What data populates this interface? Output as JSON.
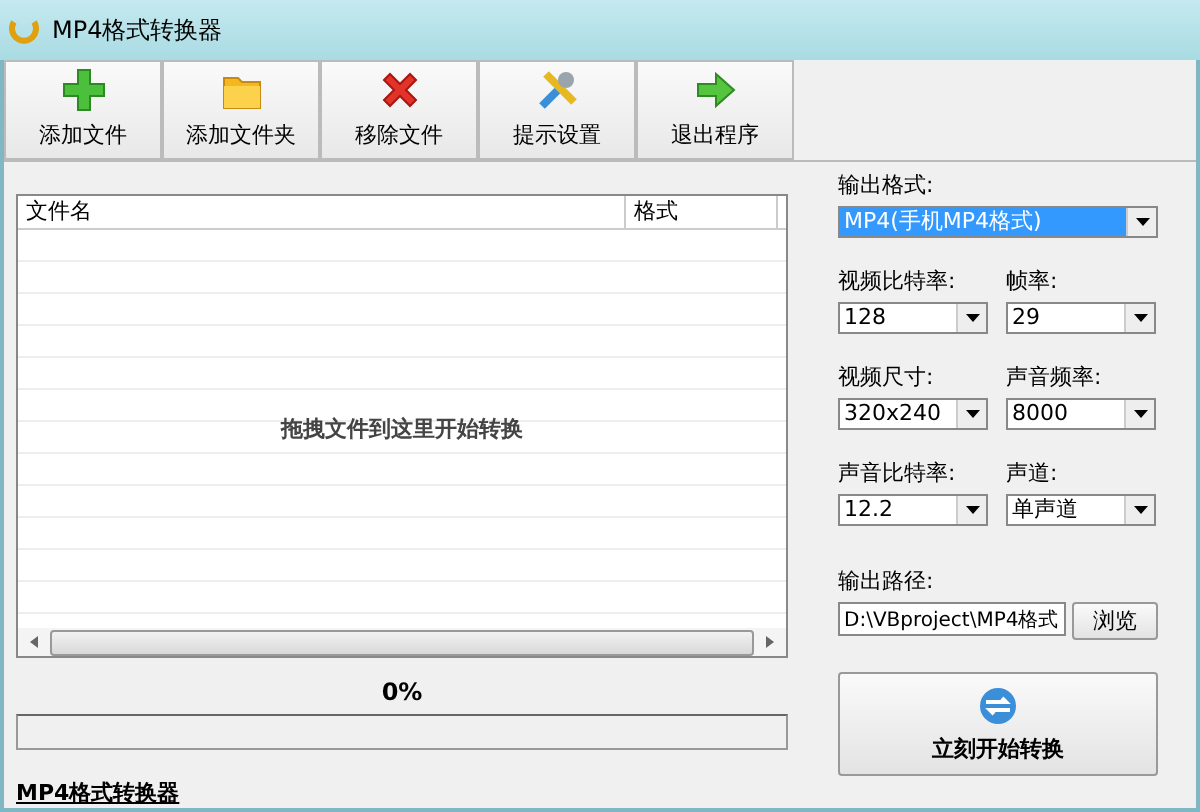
{
  "window": {
    "title": "MP4格式转换器"
  },
  "toolbar": [
    {
      "label": "添加文件",
      "kind": "add"
    },
    {
      "label": "添加文件夹",
      "kind": "folder"
    },
    {
      "label": "移除文件",
      "kind": "remove"
    },
    {
      "label": "提示设置",
      "kind": "tools"
    },
    {
      "label": "退出程序",
      "kind": "exit"
    }
  ],
  "file_list": {
    "columns": [
      "文件名",
      "格式"
    ],
    "empty_hint": "拖拽文件到这里开始转换"
  },
  "progress": {
    "reading": "0%",
    "level": 0
  },
  "footer_link": "MP4格式转换器",
  "output_format": {
    "label": "输出格式:",
    "value": "MP4(手机MP4格式)",
    "highlighted": true
  },
  "settings": [
    {
      "label": "视频比特率:",
      "value": "128",
      "highlighted": false
    },
    {
      "label": "帧率:",
      "value": "29",
      "highlighted": false
    },
    {
      "label": "视频尺寸:",
      "value": "320x240",
      "highlighted": false
    },
    {
      "label": "声音频率:",
      "value": "8000",
      "highlighted": false
    },
    {
      "label": "声音比特率:",
      "value": "12.2",
      "highlighted": false
    },
    {
      "label": "声道:",
      "value": "单声道",
      "highlighted": false
    }
  ],
  "output_path": {
    "label": "输出路径:",
    "value": "D:\\VBproject\\MP4格式",
    "browse": "浏览"
  },
  "start_button": "立刻开始转换"
}
